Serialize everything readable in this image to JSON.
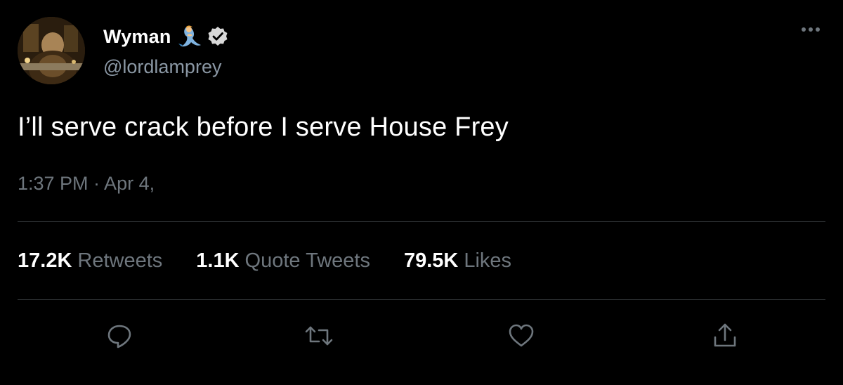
{
  "author": {
    "display_name": "Wyman",
    "handle": "@lordlamprey",
    "badges": [
      "mermaid-emoji-icon",
      "verified-badge-icon"
    ]
  },
  "tweet": {
    "text": "I’ll serve crack before I serve House Frey",
    "timestamp": "1:37 PM · Apr 4,"
  },
  "stats": {
    "retweets_count": "17.2K",
    "retweets_label": "Retweets",
    "quote_count": "1.1K",
    "quote_label": "Quote Tweets",
    "likes_count": "79.5K",
    "likes_label": "Likes"
  },
  "actions": [
    "reply-icon",
    "retweet-icon",
    "like-icon",
    "share-icon"
  ],
  "colors": {
    "background": "#000000",
    "primary_text": "#ffffff",
    "secondary_text": "#6e767d",
    "divider": "#2f3336",
    "icon": "#6e767d"
  }
}
